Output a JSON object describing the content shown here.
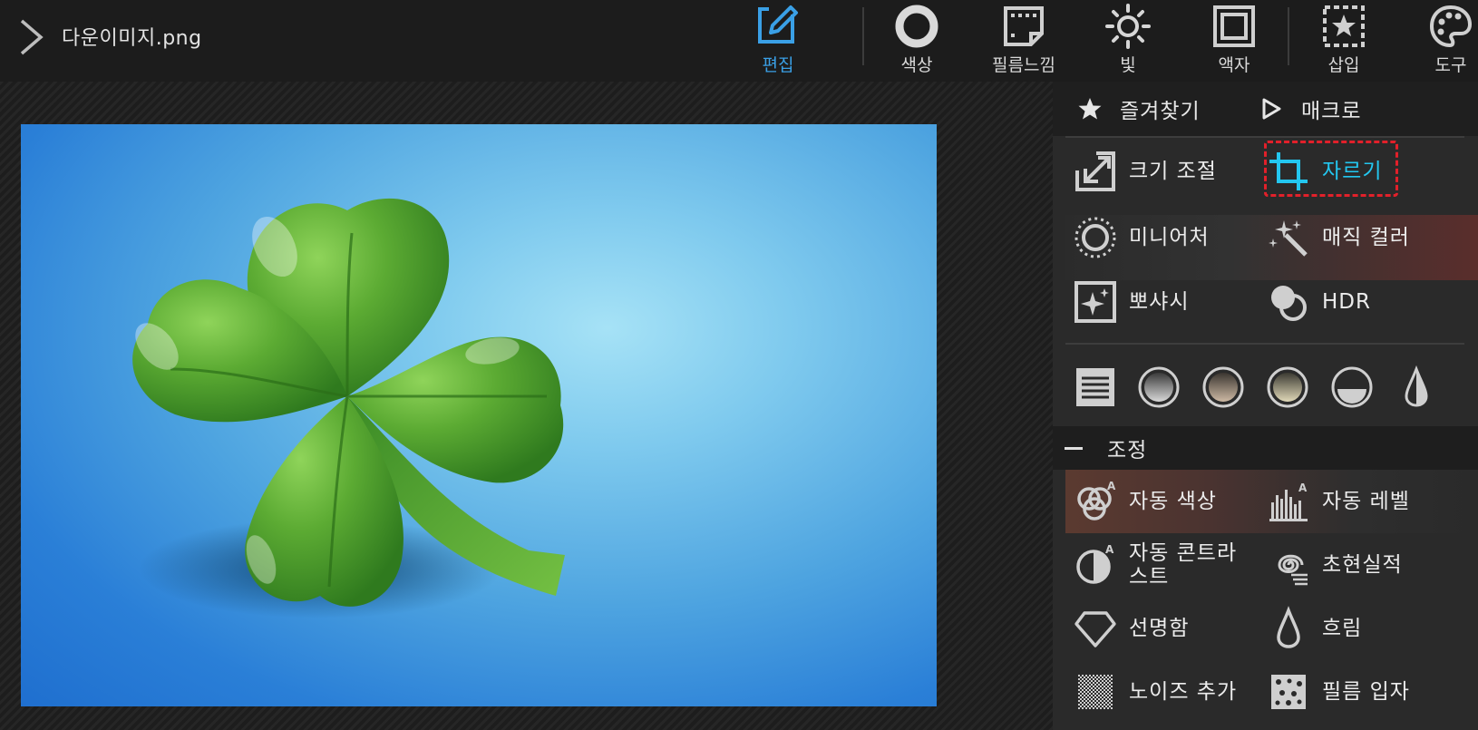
{
  "header": {
    "filename": "다운이미지.png",
    "toolbar": [
      {
        "label": "편집",
        "icon": "edit-icon",
        "active": true
      },
      {
        "label": "색상",
        "icon": "color-circle-icon"
      },
      {
        "label": "필름느낌",
        "icon": "film-icon"
      },
      {
        "label": "빛",
        "icon": "sun-icon"
      },
      {
        "label": "액자",
        "icon": "frame-icon"
      },
      {
        "label": "삽입",
        "icon": "insert-star-icon"
      },
      {
        "label": "도구",
        "icon": "palette-icon"
      }
    ]
  },
  "panel": {
    "tabs": [
      {
        "label": "즐겨찾기",
        "icon": "star-icon"
      },
      {
        "label": "매크로",
        "icon": "play-icon"
      }
    ],
    "edit_tools": [
      {
        "label": "크기 조절",
        "icon": "resize-icon"
      },
      {
        "label": "자르기",
        "icon": "crop-icon"
      },
      {
        "label": "미니어처",
        "icon": "miniature-icon"
      },
      {
        "label": "매직 컬러",
        "icon": "magic-wand-icon"
      },
      {
        "label": "뽀샤시",
        "icon": "sparkle-icon"
      },
      {
        "label": "HDR",
        "icon": "hdr-icon"
      }
    ],
    "presets": [
      "lines-preset-icon",
      "gradient-gray-preset-icon",
      "gradient-brown-preset-icon",
      "gradient-beige-preset-icon",
      "half-circle-preset-icon",
      "drop-preset-icon"
    ],
    "section_title": "조정",
    "adjust_tools": [
      {
        "label": "자동 색상",
        "icon": "auto-color-icon"
      },
      {
        "label": "자동 레벨",
        "icon": "auto-level-icon"
      },
      {
        "label": "자동 콘트라스트",
        "icon": "auto-contrast-icon"
      },
      {
        "label": "초현실적",
        "icon": "surreal-icon"
      },
      {
        "label": "선명함",
        "icon": "diamond-icon"
      },
      {
        "label": "흐림",
        "icon": "blur-drop-icon"
      },
      {
        "label": "노이즈 추가",
        "icon": "noise-icon"
      },
      {
        "label": "필름 입자",
        "icon": "film-grain-icon"
      }
    ]
  },
  "colors": {
    "accent": "#3aa0e6",
    "crop_accent": "#23c7f0",
    "highlight": "#e2202a"
  }
}
